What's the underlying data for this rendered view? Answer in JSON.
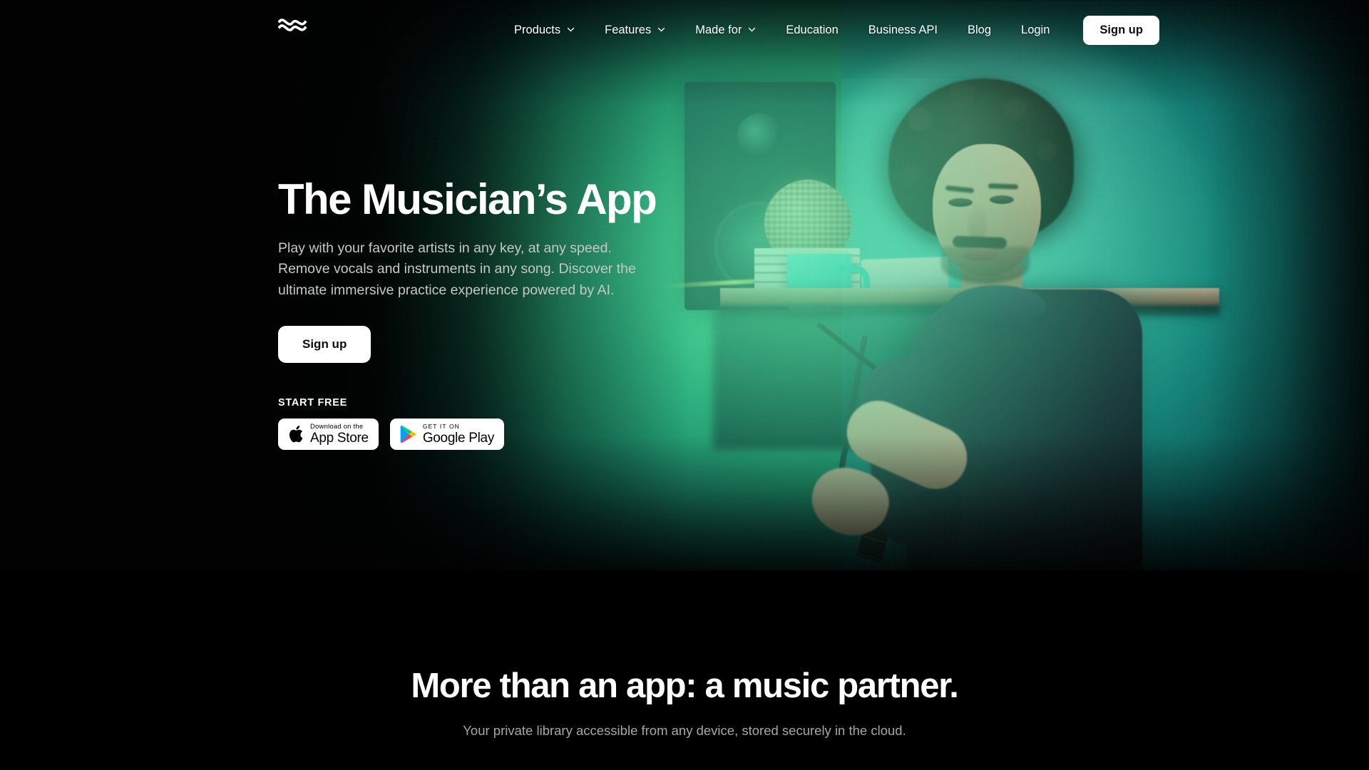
{
  "brand": {
    "logo_name": "moises-wave-logo",
    "accent_green": "#3fd195",
    "accent_teal": "#2bbfb2",
    "background": "#000000"
  },
  "nav": {
    "items": [
      {
        "label": "Products",
        "has_dropdown": true
      },
      {
        "label": "Features",
        "has_dropdown": true
      },
      {
        "label": "Made for",
        "has_dropdown": true
      },
      {
        "label": "Education",
        "has_dropdown": false
      },
      {
        "label": "Business API",
        "has_dropdown": false
      },
      {
        "label": "Blog",
        "has_dropdown": false
      },
      {
        "label": "Login",
        "has_dropdown": false
      }
    ],
    "signup_label": "Sign up"
  },
  "hero": {
    "title": "The Musician’s App",
    "subtitle": "Play with your favorite artists in any key, at any speed. Remove vocals and instruments in any song. Discover the ultimate immersive practice experience powered by AI.",
    "cta_label": "Sign up",
    "start_free_label": "START FREE",
    "badges": [
      {
        "small": "Download on the",
        "big": "App Store",
        "icon": "apple-icon"
      },
      {
        "small": "GET IT ON",
        "big": "Google Play",
        "icon": "google-play-icon"
      }
    ]
  },
  "section2": {
    "title": "More than an app: a music partner.",
    "subtitle": "Your private library accessible from any device, stored securely in the cloud."
  }
}
